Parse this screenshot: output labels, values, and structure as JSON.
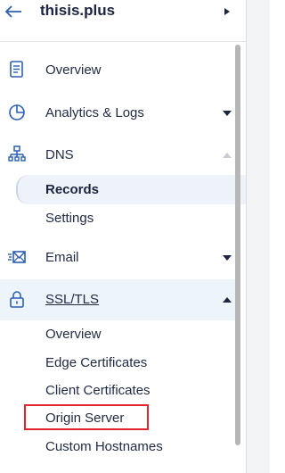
{
  "header": {
    "zone_name": "thisis.plus"
  },
  "nav": {
    "overview": "Overview",
    "analytics": "Analytics & Logs",
    "dns": "DNS",
    "dns_sub": {
      "records": "Records",
      "settings": "Settings"
    },
    "email": "Email",
    "ssl": "SSL/TLS",
    "ssl_sub": {
      "overview": "Overview",
      "edge_certificates": "Edge Certificates",
      "client_certificates": "Client Certificates",
      "origin_server": "Origin Server",
      "custom_hostnames": "Custom Hostnames"
    }
  },
  "colors": {
    "text": "#1f2a44",
    "selected_bg": "#eef3fa",
    "ssl_bg": "#edf5fb",
    "highlight_border": "#e0262b",
    "scrollbar": "#b7b7b7"
  }
}
